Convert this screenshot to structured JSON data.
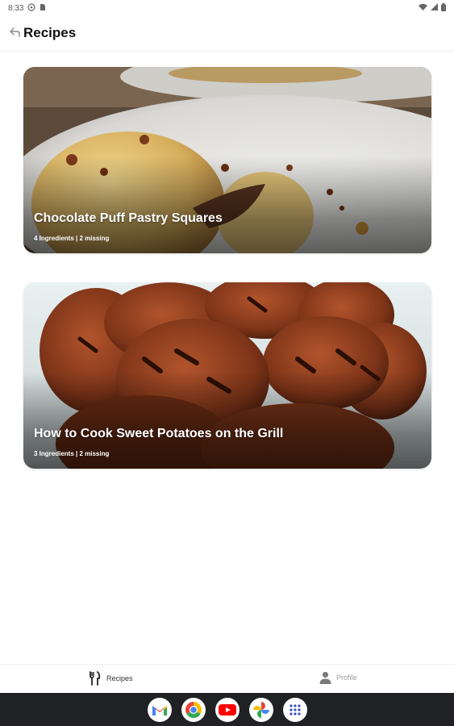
{
  "status_bar": {
    "time": "8:33",
    "icons": [
      "notification-icon",
      "sim-icon",
      "wifi-icon",
      "signal-icon",
      "battery-icon"
    ]
  },
  "app_bar": {
    "title": "Recipes",
    "back_icon": "back-arrow-icon"
  },
  "recipes": [
    {
      "title": "Chocolate Puff Pastry Squares",
      "meta": "4 Ingredients | 2 missing"
    },
    {
      "title": "How to Cook Sweet Potatoes on the Grill",
      "meta": "3 Ingredients | 2 missing"
    }
  ],
  "bottom_nav": {
    "recipes_label": "Recipes",
    "profile_label": "Profile"
  },
  "dock": {
    "apps": [
      "gmail-icon",
      "chrome-icon",
      "youtube-icon",
      "photos-icon",
      "app-drawer-icon"
    ]
  },
  "colors": {
    "text_primary": "#111111",
    "nav_active": "#333333",
    "nav_inactive": "#9a9a9a",
    "system_bar": "#1f2125"
  }
}
